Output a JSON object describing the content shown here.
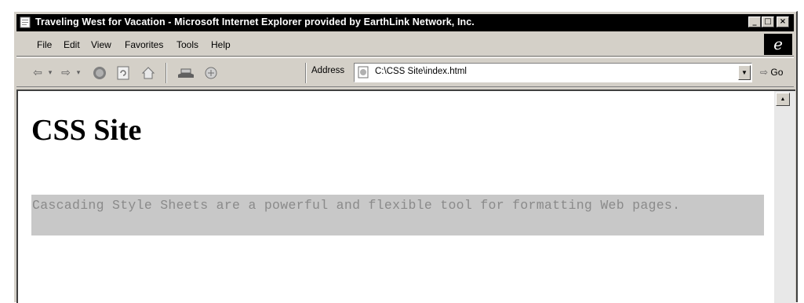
{
  "window": {
    "title": "Traveling West for Vacation - Microsoft Internet Explorer provided by EarthLink Network, Inc.",
    "minimize": "_",
    "maximize": "□",
    "close": "×"
  },
  "menu": {
    "file": "File",
    "edit": "Edit",
    "view": "View",
    "favorites": "Favorites",
    "tools": "Tools",
    "help": "Help"
  },
  "toolbar": {
    "address_label": "Address",
    "address_value": "C:\\CSS Site\\index.html",
    "go_label": "Go"
  },
  "page": {
    "heading": "CSS Site",
    "paragraph": "Cascading Style Sheets are a powerful and flexible tool for formatting Web pages."
  },
  "icons": {
    "back": "back-arrow-icon",
    "forward": "forward-arrow-icon",
    "stop": "stop-icon",
    "refresh": "refresh-icon",
    "home": "home-icon",
    "mail": "mail-icon",
    "print": "print-icon"
  }
}
